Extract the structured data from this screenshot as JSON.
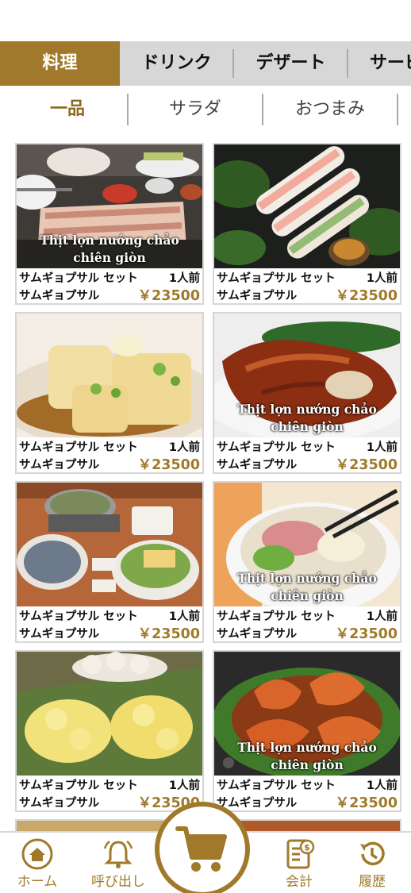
{
  "category_tabs": [
    {
      "label": "料理",
      "active": true
    },
    {
      "label": "ドリンク",
      "active": false
    },
    {
      "label": "デザート",
      "active": false
    },
    {
      "label": "サービス",
      "active": false
    }
  ],
  "sub_tabs": [
    {
      "label": "一品",
      "active": true
    },
    {
      "label": "サラダ",
      "active": false
    },
    {
      "label": "おつまみ",
      "active": false
    }
  ],
  "items": [
    {
      "overlay": "Thịt lợn nướng chảo chiên giòn",
      "set_label": "サムギョプサル セット",
      "portion": "1人前",
      "name": "サムギョプサル",
      "price": "￥23500",
      "image": "samgyeopsal-platter"
    },
    {
      "overlay": "",
      "set_label": "サムギョプサル セット",
      "portion": "1人前",
      "name": "サムギョプサル",
      "price": "￥23500",
      "image": "spring-rolls"
    },
    {
      "overlay": "",
      "set_label": "サムギョプサル セット",
      "portion": "1人前",
      "name": "サムギョプサル",
      "price": "￥23500",
      "image": "agedashi-tofu"
    },
    {
      "overlay": "Thịt lợn nướng chảo chiên giòn",
      "set_label": "サムギョプサル セット",
      "portion": "1人前",
      "name": "サムギョプサル",
      "price": "￥23500",
      "image": "roast-duck"
    },
    {
      "overlay": "",
      "set_label": "サムギョプサル セット",
      "portion": "1人前",
      "name": "サムギョプサル",
      "price": "￥23500",
      "image": "hotpot-spread"
    },
    {
      "overlay": "Thịt lợn nướng chảo chiên giòn",
      "set_label": "サムギョプサル セット",
      "portion": "1人前",
      "name": "サムギョプサル",
      "price": "￥23500",
      "image": "pho-bowl"
    },
    {
      "overlay": "",
      "set_label": "サムギョプサル セット",
      "portion": "1人前",
      "name": "サムギョプサル",
      "price": "￥23500",
      "image": "fried-shirako"
    },
    {
      "overlay": "Thịt lợn nướng chảo chiên giòn",
      "set_label": "サムギョプサル セット",
      "portion": "1人前",
      "name": "サムギョプサル",
      "price": "￥23500",
      "image": "tamarind-shrimp"
    }
  ],
  "bottom_nav": {
    "home": "ホーム",
    "call": "呼び出し",
    "checkout": "会計",
    "history": "履歴",
    "cart_icon": "cart-icon"
  },
  "colors": {
    "accent": "#a07a2a",
    "tab_bar": "#d7d7d7",
    "separator": "#a9a9a9"
  }
}
